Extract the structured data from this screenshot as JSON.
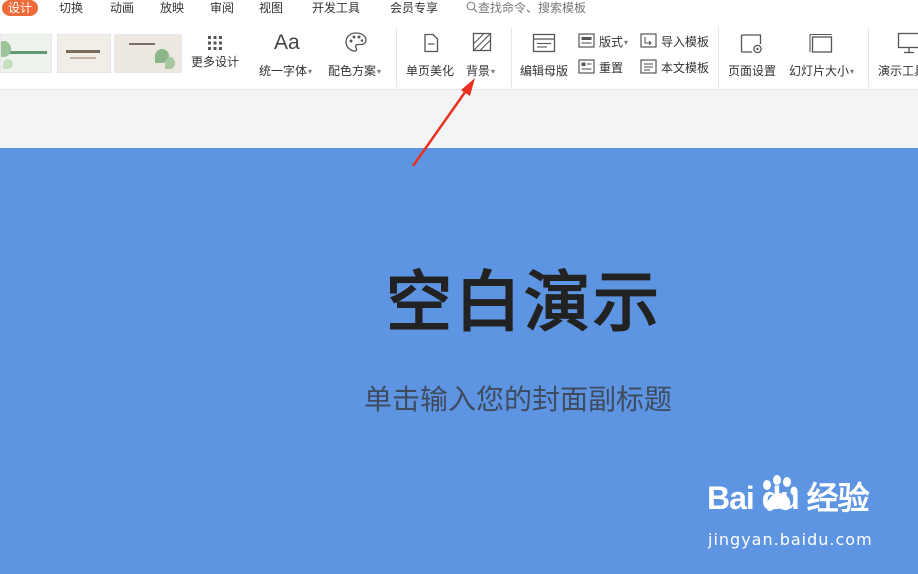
{
  "menubar": {
    "tabs": [
      {
        "label": "设计",
        "active": true
      },
      {
        "label": "切换"
      },
      {
        "label": "动画"
      },
      {
        "label": "放映"
      },
      {
        "label": "审阅"
      },
      {
        "label": "视图"
      },
      {
        "label": "开发工具"
      },
      {
        "label": "会员专享"
      }
    ],
    "search_placeholder": "查找命令、搜索模板"
  },
  "ribbon": {
    "more_design": "更多设计",
    "unify_font": "统一字体",
    "color_scheme": "配色方案",
    "single_page_beautify": "单页美化",
    "background": "背景",
    "edit_master": "编辑母版",
    "layout": "版式",
    "reset": "重置",
    "import_template": "导入模板",
    "this_template": "本文模板",
    "page_setup": "页面设置",
    "slide_size": "幻灯片大小",
    "presentation_tools": "演示工具"
  },
  "slide": {
    "title": "空白演示",
    "subtitle": "单击输入您的封面副标题",
    "background_color": "#5e95e3"
  },
  "watermark": {
    "text": "Bai du 经验",
    "url": "jingyan.baidu.com"
  },
  "colors": {
    "accent": "#ee6b3a",
    "annotation_arrow": "#e8301f"
  }
}
